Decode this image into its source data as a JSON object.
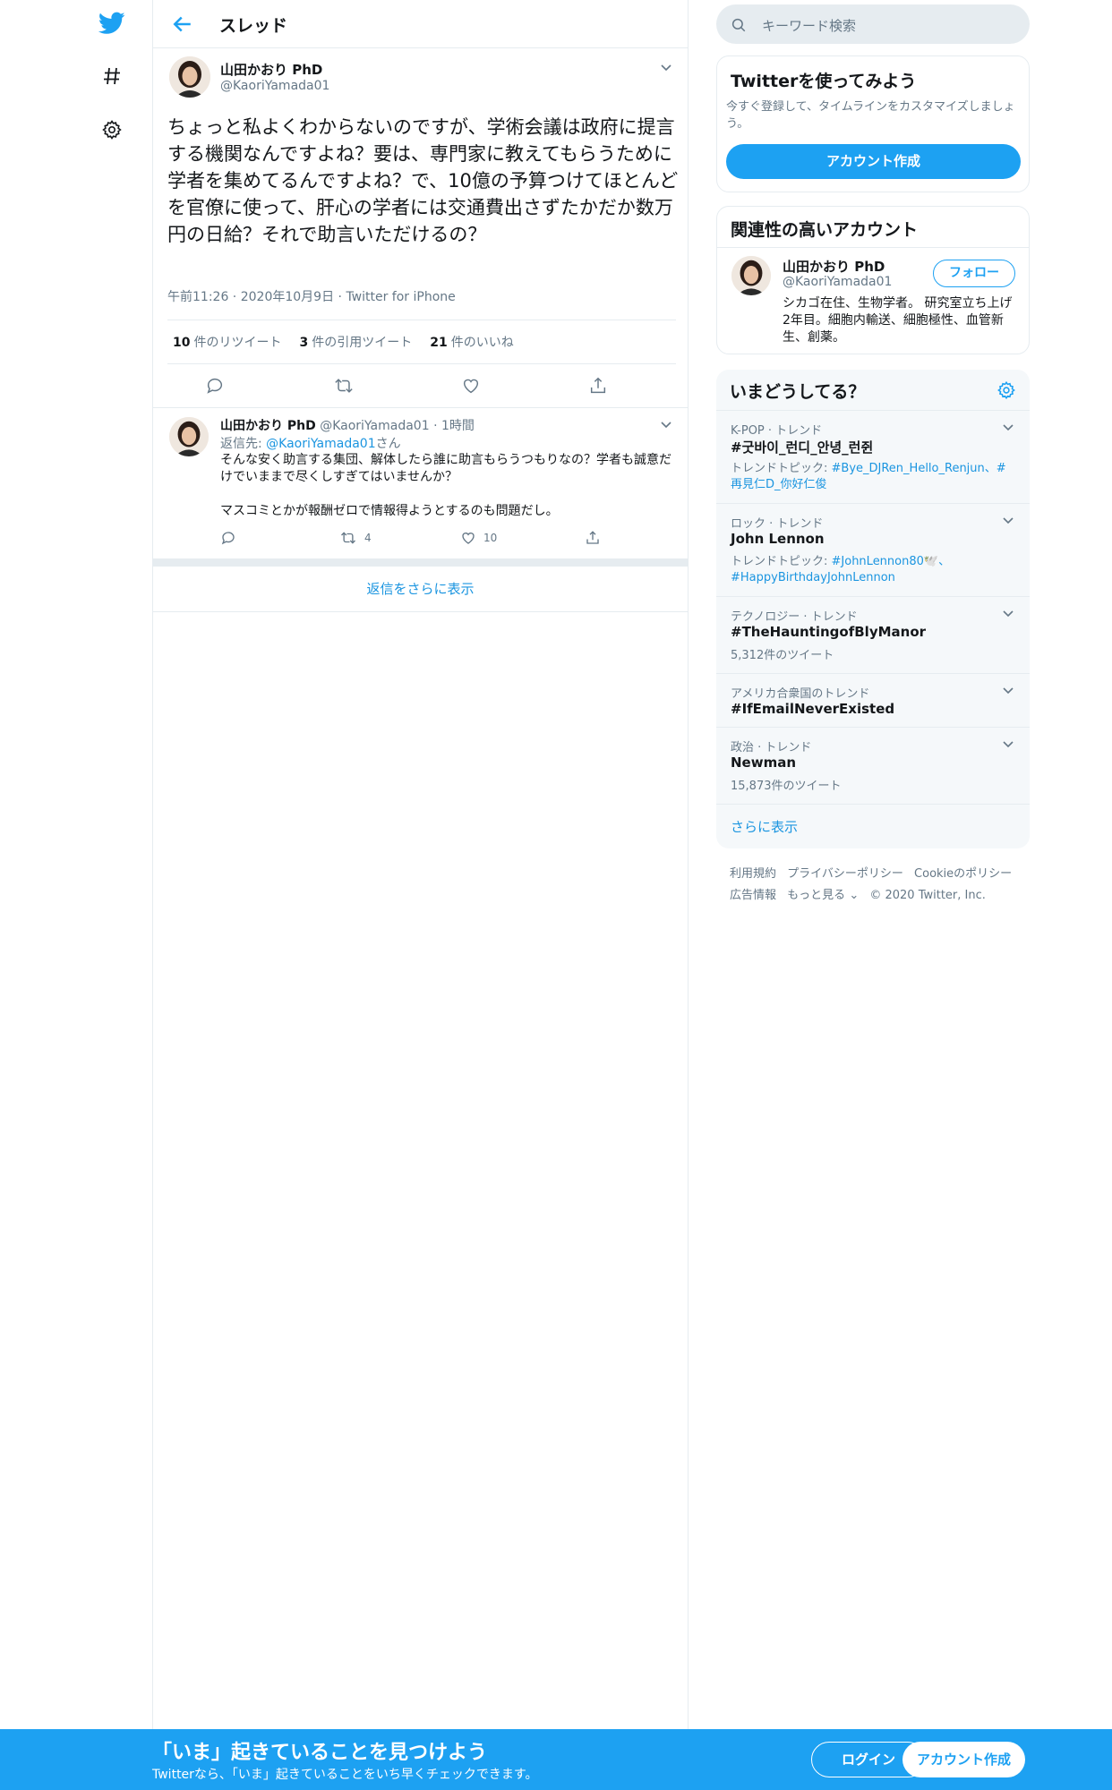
{
  "header": {
    "title": "スレッド"
  },
  "tweet": {
    "name": "山田かおり PhD",
    "handle": "@KaoriYamada01",
    "text": "ちょっと私よくわからないのですが、学術会議は政府に提言する機関なんですよね？要は、専門家に教えてもらうために学者を集めてるんですよね？で、10億の予算つけてほとんどを官僚に使って、肝心の学者には交通費出さずたかだか数万円の日給？それで助言いただけるの？",
    "time": "午前11:26",
    "date": "2020年10月9日",
    "client": "Twitter for iPhone",
    "retweets_count": "10",
    "retweets_label": "件のリツイート",
    "quotes_count": "3",
    "quotes_label": "件の引用ツイート",
    "likes_count": "21",
    "likes_label": "件のいいね"
  },
  "reply": {
    "name": "山田かおり PhD",
    "handle": "@KaoriYamada01",
    "age": "1時間",
    "reply_prefix": "返信先: ",
    "reply_to": "@KaoriYamada01",
    "reply_suffix": "さん",
    "text": "そんな安く助言する集団、解体したら誰に助言もらうつもりなの？学者も誠意だけでいままで尽くしすぎてはいませんか？\n\nマスコミとかが報酬ゼロで情報得ようとするのも問題だし。",
    "retweets": "4",
    "likes": "10"
  },
  "more_replies": "返信をさらに表示",
  "search": {
    "placeholder": "キーワード検索"
  },
  "signup_card": {
    "title": "Twitterを使ってみよう",
    "desc": "今すぐ登録して、タイムラインをカスタマイズしましょう。",
    "button": "アカウント作成"
  },
  "related": {
    "title": "関連性の高いアカウント",
    "name": "山田かおり PhD",
    "handle": "@KaoriYamada01",
    "follow": "フォロー",
    "bio": "シカゴ在住、生物学者。 研究室立ち上げ2年目。細胞内輸送、細胞極性、血管新生、創薬。"
  },
  "trends": {
    "title": "いまどうしてる？",
    "items": [
      {
        "category": "K-POP · トレンド",
        "name": "#굿바이_런디_안녕_런쥔",
        "sub_prefix": "トレンドトピック: ",
        "sub_links": "#Bye_DJRen_Hello_Renjun、#再見仁D_你好仁俊"
      },
      {
        "category": "ロック · トレンド",
        "name": "John Lennon",
        "sub_prefix": "トレンドトピック: ",
        "sub_links": "#JohnLennon80🕊️、#HappyBirthdayJohnLennon"
      },
      {
        "category": "テクノロジー · トレンド",
        "name": "#TheHauntingofBlyManor",
        "count": "5,312件のツイート"
      },
      {
        "category": "アメリカ合衆国のトレンド",
        "name": "#IfEmailNeverExisted"
      },
      {
        "category": "政治 · トレンド",
        "name": "Newman",
        "count": "15,873件のツイート"
      }
    ],
    "show_more": "さらに表示"
  },
  "footer": {
    "terms": "利用規約",
    "privacy": "プライバシーポリシー",
    "cookie": "Cookieのポリシー",
    "ads": "広告情報",
    "more": "もっと見る",
    "copyright": "© 2020 Twitter, Inc."
  },
  "bottombar": {
    "title": "「いま」起きていることを見つけよう",
    "subtitle": "Twitterなら、「いま」起きていることをいち早くチェックできます。",
    "login": "ログイン",
    "signup": "アカウント作成"
  },
  "colors": {
    "brand": "#1da1f2",
    "link": "#1b95e0",
    "text": "#14171a",
    "muted": "#657786",
    "border": "#e6ecf0"
  }
}
